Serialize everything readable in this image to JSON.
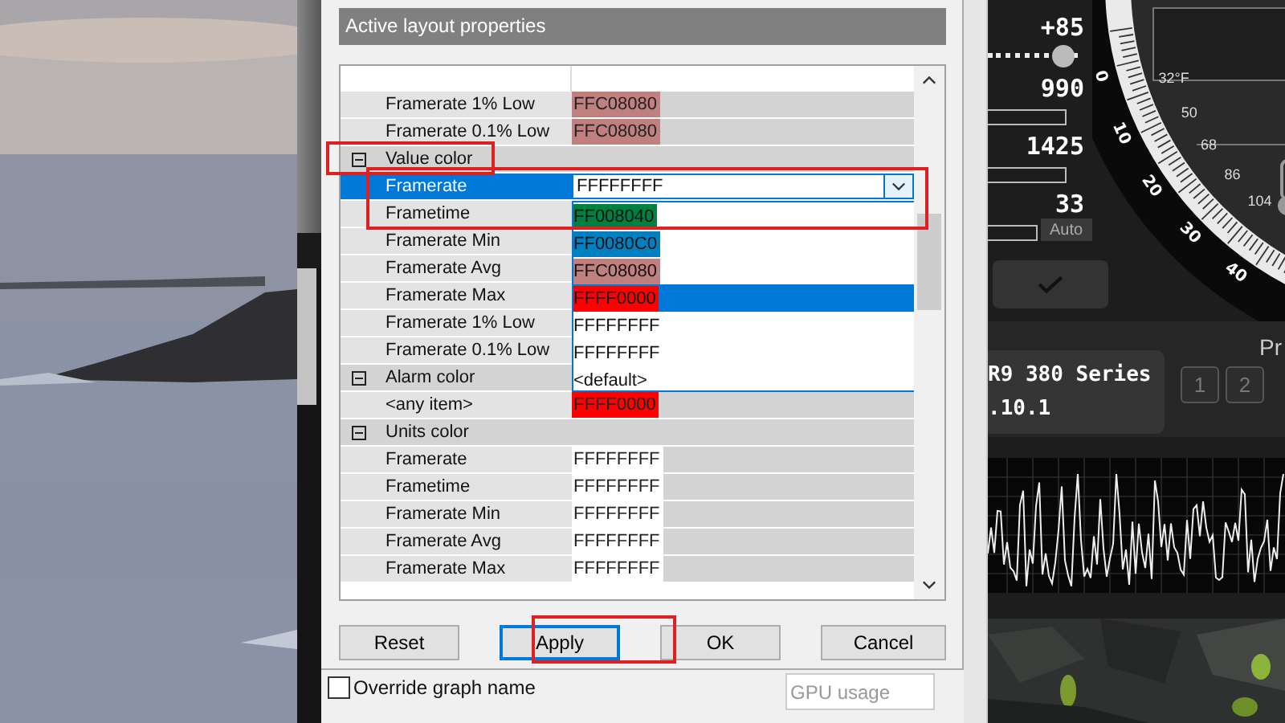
{
  "panel_title": "Active layout properties",
  "grid": {
    "rows": [
      {
        "kind": "item",
        "label": "Framerate 1% Low",
        "value": "FFC08080",
        "color": "#c08080",
        "selected": false
      },
      {
        "kind": "item",
        "label": "Framerate 0.1% Low",
        "value": "FFC08080",
        "color": "#c08080",
        "selected": false
      },
      {
        "kind": "category",
        "label": "Value color",
        "expanded": true
      },
      {
        "kind": "item",
        "label": "Framerate",
        "selected": true
      },
      {
        "kind": "item",
        "label": "Frametime",
        "selected": false
      },
      {
        "kind": "item",
        "label": "Framerate Min",
        "selected": false
      },
      {
        "kind": "item",
        "label": "Framerate Avg",
        "selected": false
      },
      {
        "kind": "item",
        "label": "Framerate Max",
        "selected": false
      },
      {
        "kind": "item",
        "label": "Framerate 1% Low",
        "selected": false
      },
      {
        "kind": "item",
        "label": "Framerate 0.1% Low",
        "selected": false
      },
      {
        "kind": "category",
        "label": "Alarm color",
        "expanded": true
      },
      {
        "kind": "item",
        "label": "<any item>",
        "value": "FFFF0000",
        "color": "#ff0000",
        "selected": false
      },
      {
        "kind": "category",
        "label": "Units color",
        "expanded": true
      },
      {
        "kind": "item",
        "label": "Framerate",
        "value": "FFFFFFFF",
        "color": "#ffffff",
        "selected": false
      },
      {
        "kind": "item",
        "label": "Frametime",
        "value": "FFFFFFFF",
        "color": "#ffffff",
        "selected": false
      },
      {
        "kind": "item",
        "label": "Framerate Min",
        "value": "FFFFFFFF",
        "color": "#ffffff",
        "selected": false
      },
      {
        "kind": "item",
        "label": "Framerate Avg",
        "value": "FFFFFFFF",
        "color": "#ffffff",
        "selected": false
      },
      {
        "kind": "item",
        "label": "Framerate Max",
        "value": "FFFFFFFF",
        "color": "#ffffff",
        "selected": false
      }
    ],
    "combo_value": "FFFFFFFF",
    "options": [
      {
        "label": "FF008040",
        "color": "#008040",
        "selected": false
      },
      {
        "label": "FF0080C0",
        "color": "#0080c0",
        "selected": false
      },
      {
        "label": "FFC08080",
        "color": "#c08080",
        "selected": false
      },
      {
        "label": "FFFF0000",
        "color": "#ff0000",
        "selected": true
      },
      {
        "label": "FFFFFFFF",
        "selected": false
      },
      {
        "label": "FFFFFFFF",
        "selected": false
      },
      {
        "label": "<default>",
        "selected": false
      }
    ]
  },
  "buttons": [
    {
      "label": "Reset",
      "focused": false
    },
    {
      "label": "Apply",
      "focused": true
    },
    {
      "label": "OK",
      "focused": false
    },
    {
      "label": "Cancel",
      "focused": false
    }
  ],
  "override": {
    "label": "Override graph name",
    "checked": false,
    "placeholder": "GPU usage"
  },
  "skin": {
    "controls": [
      {
        "kind": "slider",
        "value": "+85",
        "level": 0.88
      },
      {
        "kind": "bar",
        "value": "990"
      },
      {
        "kind": "bar",
        "value": "1425"
      },
      {
        "kind": "auto",
        "value": "33",
        "button": "Auto"
      }
    ],
    "outer_scale": [
      "0",
      "10",
      "20",
      "30",
      "40"
    ],
    "inner_scale": [
      "32°F",
      "50",
      "68",
      "86",
      "104"
    ],
    "card_name": "R9 380 Series",
    "driver": ".10.1",
    "profile_label": "Pr",
    "profiles": [
      "1",
      "2"
    ]
  }
}
